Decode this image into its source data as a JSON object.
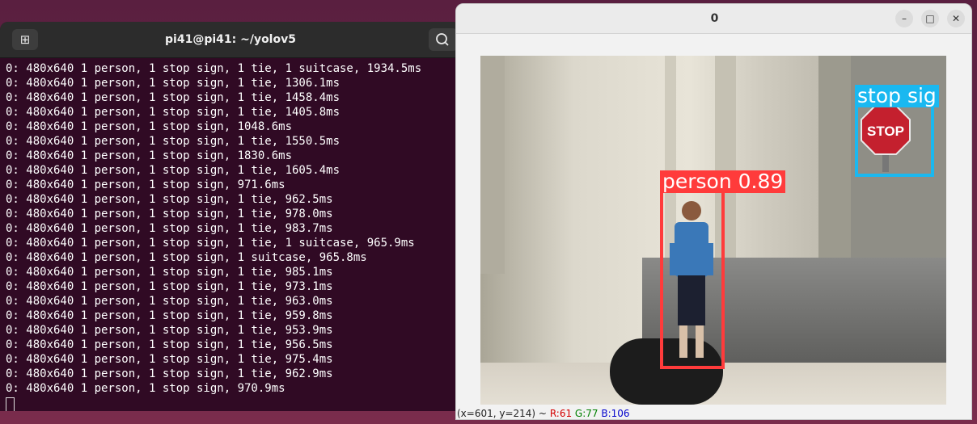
{
  "terminal": {
    "title": "pi41@pi41: ~/yolov5",
    "new_tab_icon": "new-tab-icon",
    "search_icon": "search-icon",
    "lines": [
      "0: 480x640 1 person, 1 stop sign, 1 tie, 1 suitcase, 1934.5ms",
      "0: 480x640 1 person, 1 stop sign, 1 tie, 1306.1ms",
      "0: 480x640 1 person, 1 stop sign, 1 tie, 1458.4ms",
      "0: 480x640 1 person, 1 stop sign, 1 tie, 1405.8ms",
      "0: 480x640 1 person, 1 stop sign, 1048.6ms",
      "0: 480x640 1 person, 1 stop sign, 1 tie, 1550.5ms",
      "0: 480x640 1 person, 1 stop sign, 1830.6ms",
      "0: 480x640 1 person, 1 stop sign, 1 tie, 1605.4ms",
      "0: 480x640 1 person, 1 stop sign, 971.6ms",
      "0: 480x640 1 person, 1 stop sign, 1 tie, 962.5ms",
      "0: 480x640 1 person, 1 stop sign, 1 tie, 978.0ms",
      "0: 480x640 1 person, 1 stop sign, 1 tie, 983.7ms",
      "0: 480x640 1 person, 1 stop sign, 1 tie, 1 suitcase, 965.9ms",
      "0: 480x640 1 person, 1 stop sign, 1 suitcase, 965.8ms",
      "0: 480x640 1 person, 1 stop sign, 1 tie, 985.1ms",
      "0: 480x640 1 person, 1 stop sign, 1 tie, 973.1ms",
      "0: 480x640 1 person, 1 stop sign, 1 tie, 963.0ms",
      "0: 480x640 1 person, 1 stop sign, 1 tie, 959.8ms",
      "0: 480x640 1 person, 1 stop sign, 1 tie, 953.9ms",
      "0: 480x640 1 person, 1 stop sign, 1 tie, 956.5ms",
      "0: 480x640 1 person, 1 stop sign, 1 tie, 975.4ms",
      "0: 480x640 1 person, 1 stop sign, 1 tie, 962.9ms",
      "0: 480x640 1 person, 1 stop sign, 970.9ms"
    ]
  },
  "image_window": {
    "title": "0",
    "minimize_icon": "minimize-icon",
    "maximize_icon": "maximize-icon",
    "close_icon": "close-icon",
    "detections": {
      "person_label": "person 0.89",
      "person_color": "#ff3b3b",
      "stop_label": "stop sig",
      "stop_color": "#1ab8f0",
      "stop_sign_text": "STOP"
    },
    "status": {
      "coords": "(x=601, y=214) ~",
      "r": "R:61",
      "g": "G:77",
      "b": "B:106"
    }
  }
}
